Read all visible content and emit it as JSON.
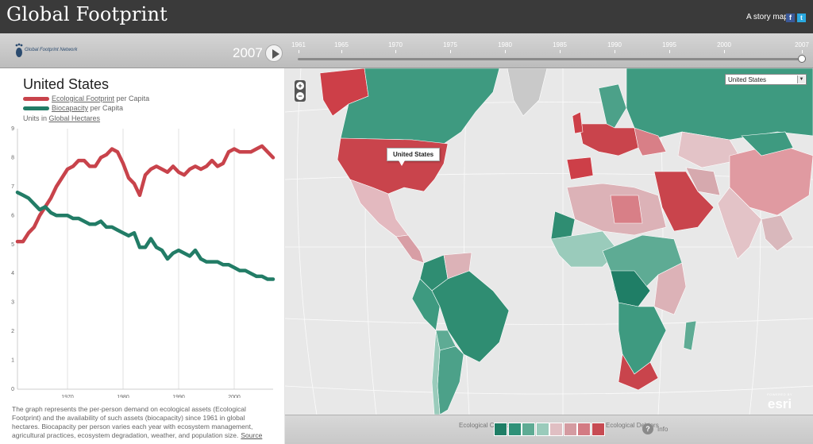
{
  "header": {
    "title": "Global Footprint",
    "story_label": "A story map",
    "facebook": "f",
    "twitter": "t"
  },
  "logo": {
    "text": "Global Footprint Network"
  },
  "timeline": {
    "current_year": "2007",
    "ticks": [
      "1961",
      "1965",
      "1970",
      "1975",
      "1980",
      "1985",
      "1990",
      "1995",
      "2000",
      "2007"
    ],
    "position": 1.0
  },
  "panel": {
    "country": "United States",
    "legend_footprint_link": "Ecological Footprint",
    "legend_footprint_suffix": " per Capita",
    "legend_bio_link": "Biocapacity",
    "legend_bio_suffix": " per Capita",
    "units_prefix": "Units in ",
    "units_link": "Global Hectares",
    "description": "The graph represents the per-person demand on ecological assets (Ecological Footprint) and the availability of such assets (biocapacity) since 1961 in global hectares. Biocapacity per person varies each year with ecosystem management, agricultural practices, ecosystem degradation, weather, and population size.",
    "source_link": "Source"
  },
  "chart_data": {
    "type": "line",
    "x": [
      1961,
      1962,
      1963,
      1964,
      1965,
      1966,
      1967,
      1968,
      1969,
      1970,
      1971,
      1972,
      1973,
      1974,
      1975,
      1976,
      1977,
      1978,
      1979,
      1980,
      1981,
      1982,
      1983,
      1984,
      1985,
      1986,
      1987,
      1988,
      1989,
      1990,
      1991,
      1992,
      1993,
      1994,
      1995,
      1996,
      1997,
      1998,
      1999,
      2000,
      2001,
      2002,
      2003,
      2004,
      2005,
      2006,
      2007
    ],
    "series": [
      {
        "name": "Ecological Footprint per Capita",
        "color": "#c8434b",
        "values": [
          5.1,
          5.1,
          5.4,
          5.6,
          6.0,
          6.3,
          6.6,
          7.0,
          7.3,
          7.6,
          7.7,
          7.9,
          7.9,
          7.7,
          7.7,
          8.0,
          8.1,
          8.3,
          8.2,
          7.8,
          7.3,
          7.1,
          6.7,
          7.4,
          7.6,
          7.7,
          7.6,
          7.5,
          7.7,
          7.5,
          7.4,
          7.6,
          7.7,
          7.6,
          7.7,
          7.9,
          7.7,
          7.8,
          8.2,
          8.3,
          8.2,
          8.2,
          8.2,
          8.3,
          8.4,
          8.2,
          8.0
        ]
      },
      {
        "name": "Biocapacity per Capita",
        "color": "#227c66",
        "values": [
          6.8,
          6.7,
          6.6,
          6.4,
          6.2,
          6.3,
          6.1,
          6.0,
          6.0,
          6.0,
          5.9,
          5.9,
          5.8,
          5.7,
          5.7,
          5.8,
          5.6,
          5.6,
          5.5,
          5.4,
          5.3,
          5.4,
          4.9,
          4.9,
          5.2,
          4.9,
          4.8,
          4.5,
          4.7,
          4.8,
          4.7,
          4.6,
          4.8,
          4.5,
          4.4,
          4.4,
          4.4,
          4.3,
          4.3,
          4.2,
          4.1,
          4.1,
          4.0,
          3.9,
          3.9,
          3.8,
          3.8
        ]
      }
    ],
    "xlabel": "",
    "ylabel": "",
    "xticks": [
      1970,
      1980,
      1990,
      2000
    ],
    "yticks": [
      0,
      1,
      2,
      3,
      4,
      5,
      6,
      7,
      8,
      9
    ],
    "xlim": [
      1961,
      2007
    ],
    "ylim": [
      0,
      9
    ],
    "grid": "vertical-only"
  },
  "map": {
    "selected_country": "United States",
    "select_arrow": "▼",
    "tooltip": "United States",
    "zoom_in": "+",
    "zoom_out": "−",
    "esri_small": "POWERED BY",
    "esri_big": "esri"
  },
  "scale": {
    "creditors_label": "Ecological Creditors",
    "debtors_label": "Ecological Debtors",
    "colors": [
      "#1f7e66",
      "#2f9178",
      "#5eab94",
      "#9acbbb",
      "#e0bfc3",
      "#d49ba1",
      "#d37b83",
      "#c74b53"
    ],
    "info_icon": "?",
    "info_label": "Info"
  }
}
